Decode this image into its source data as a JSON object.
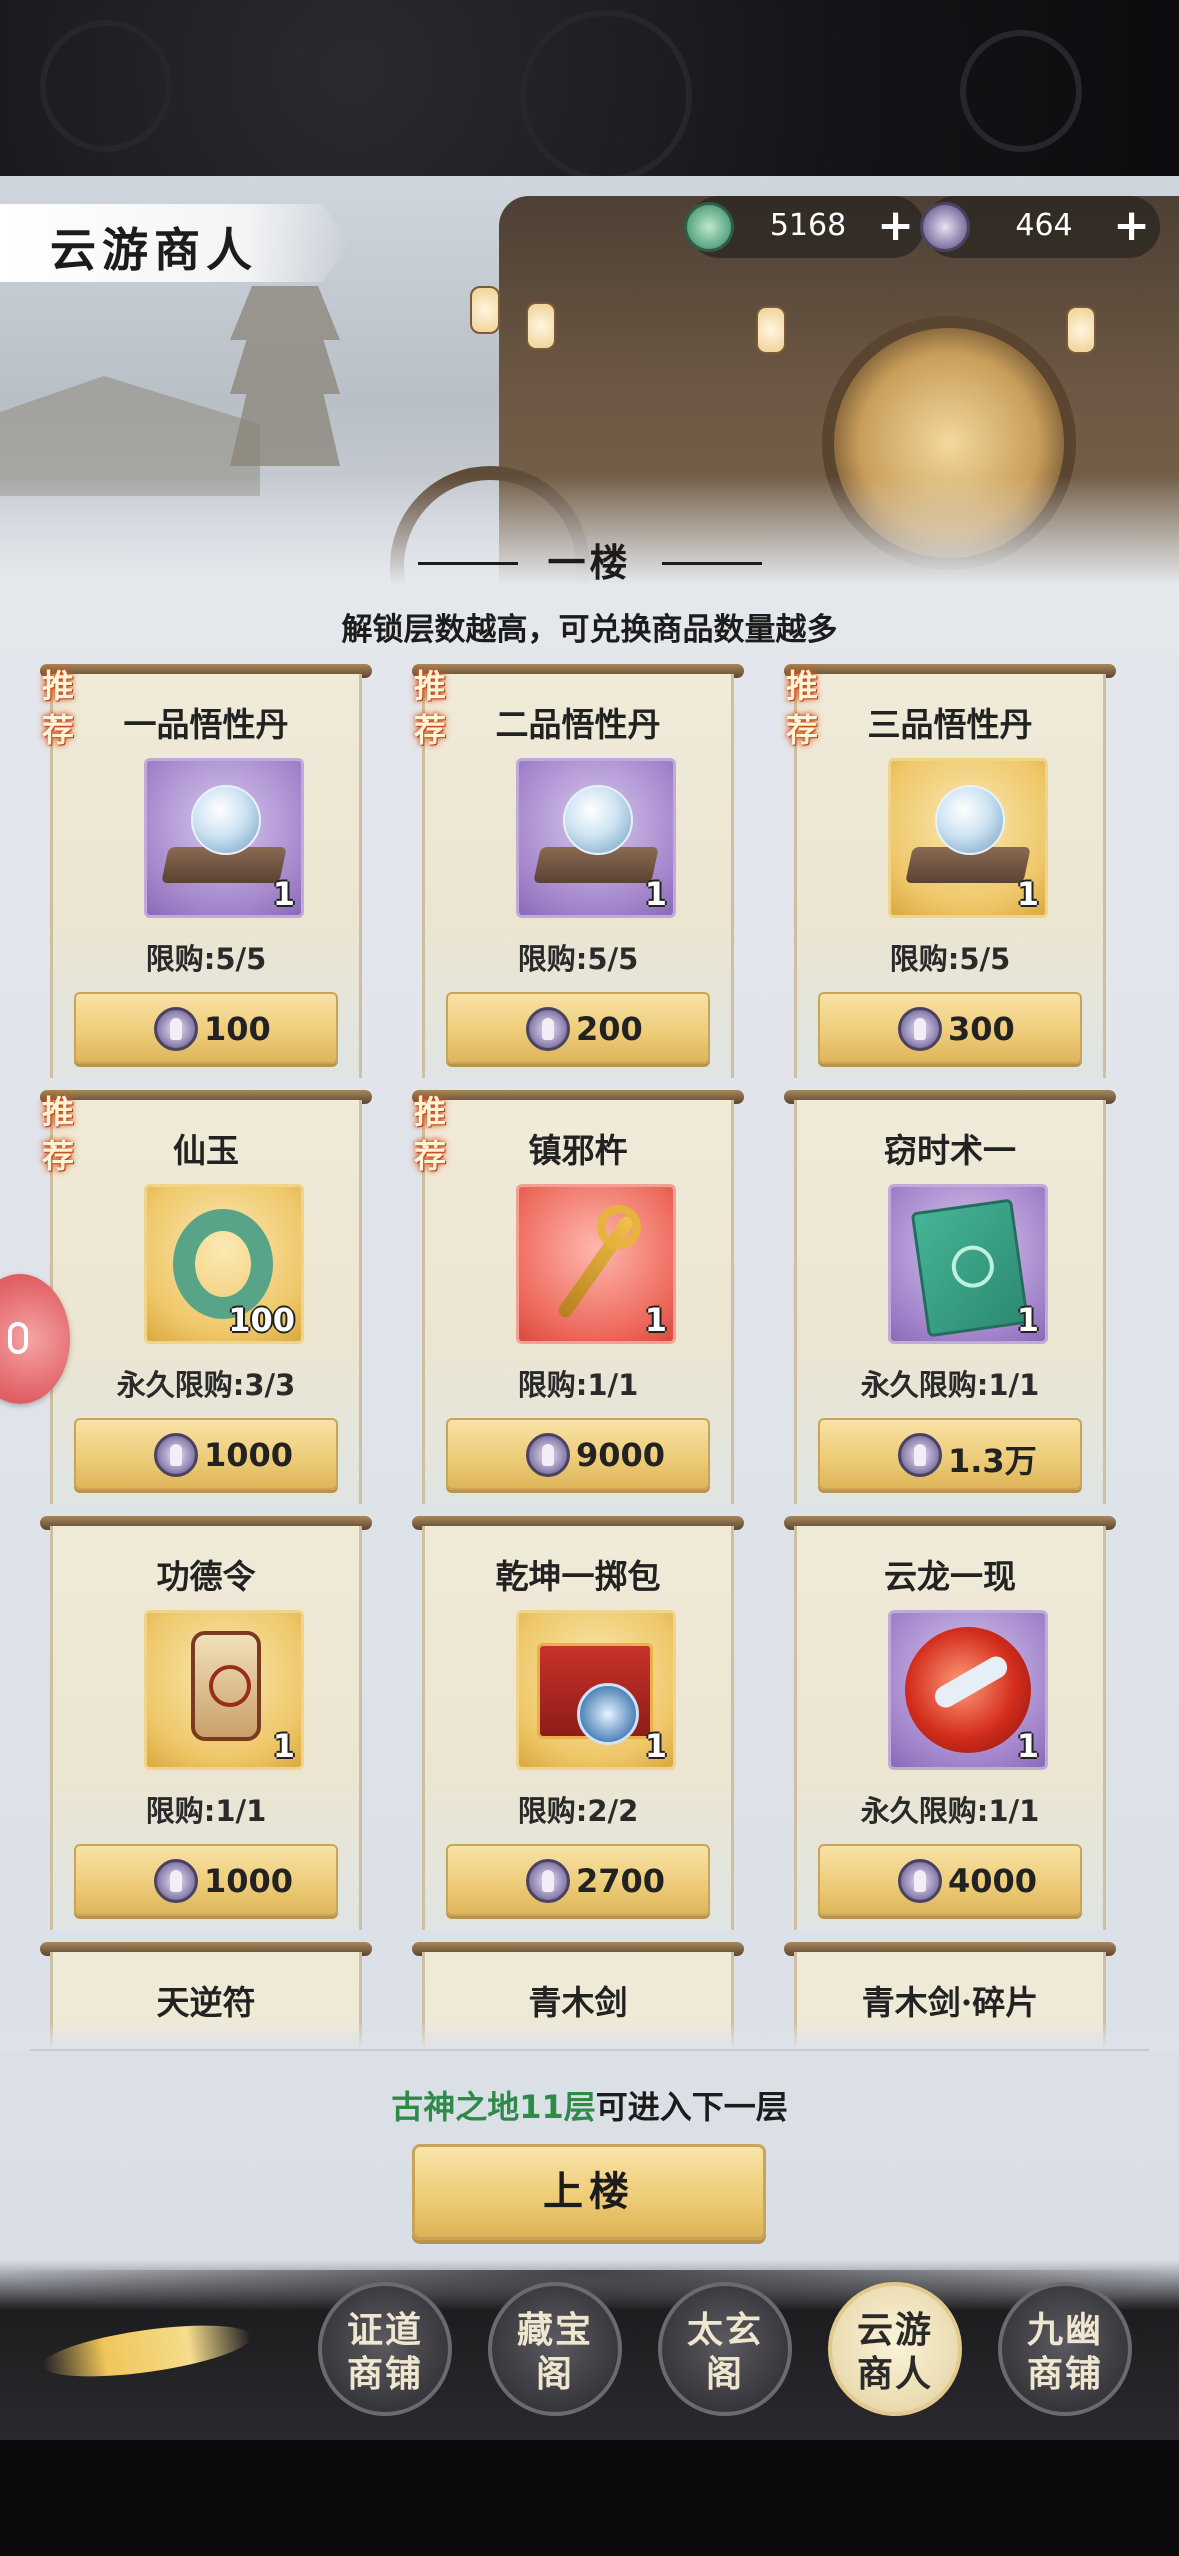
{
  "header": {
    "title": "云游商人",
    "currency": [
      {
        "icon": "jade-icon",
        "value": "5168",
        "plus": "+"
      },
      {
        "icon": "coin-icon",
        "value": "464",
        "plus": "+"
      }
    ]
  },
  "floor": {
    "title": "一楼",
    "subtitle": "解锁层数越高，可兑换商品数量越多"
  },
  "badge_text": "推\n荐",
  "items": [
    {
      "name": "一品悟性丹",
      "qty": "1",
      "limit": "限购:5/5",
      "price": "100",
      "recommended": true,
      "bg": "purple",
      "art": "orb"
    },
    {
      "name": "二品悟性丹",
      "qty": "1",
      "limit": "限购:5/5",
      "price": "200",
      "recommended": true,
      "bg": "purple",
      "art": "orb"
    },
    {
      "name": "三品悟性丹",
      "qty": "1",
      "limit": "限购:5/5",
      "price": "300",
      "recommended": true,
      "bg": "gold",
      "art": "orb"
    },
    {
      "name": "仙玉",
      "qty": "100",
      "limit": "永久限购:3/3",
      "price": "1000",
      "recommended": true,
      "bg": "gold",
      "art": "jade"
    },
    {
      "name": "镇邪杵",
      "qty": "1",
      "limit": "限购:1/1",
      "price": "9000",
      "recommended": true,
      "bg": "red",
      "art": "scepter"
    },
    {
      "name": "窃时术一",
      "qty": "1",
      "limit": "永久限购:1/1",
      "price": "1.3万",
      "recommended": false,
      "bg": "purple",
      "art": "book"
    },
    {
      "name": "功德令",
      "qty": "1",
      "limit": "限购:1/1",
      "price": "1000",
      "recommended": false,
      "bg": "gold",
      "art": "token"
    },
    {
      "name": "乾坤一掷包",
      "qty": "1",
      "limit": "限购:2/2",
      "price": "2700",
      "recommended": false,
      "bg": "gold",
      "art": "box"
    },
    {
      "name": "云龙一现",
      "qty": "1",
      "limit": "永久限购:1/1",
      "price": "4000",
      "recommended": false,
      "bg": "purple",
      "art": "dragon"
    },
    {
      "name": "天逆符",
      "recommended": false
    },
    {
      "name": "青木剑",
      "recommended": false
    },
    {
      "name": "青木剑·碎片",
      "recommended": false
    }
  ],
  "unlock": {
    "highlight": "古神之地11层",
    "text": "可进入下一层"
  },
  "up_button": "上楼",
  "nav": [
    {
      "line1": "证道",
      "line2": "商铺",
      "active": false
    },
    {
      "line1": "藏宝",
      "line2": "阁",
      "active": false
    },
    {
      "line1": "太玄",
      "line2": "阁",
      "active": false
    },
    {
      "line1": "云游",
      "line2": "商人",
      "active": true
    },
    {
      "line1": "九幽",
      "line2": "商铺",
      "active": false
    }
  ]
}
